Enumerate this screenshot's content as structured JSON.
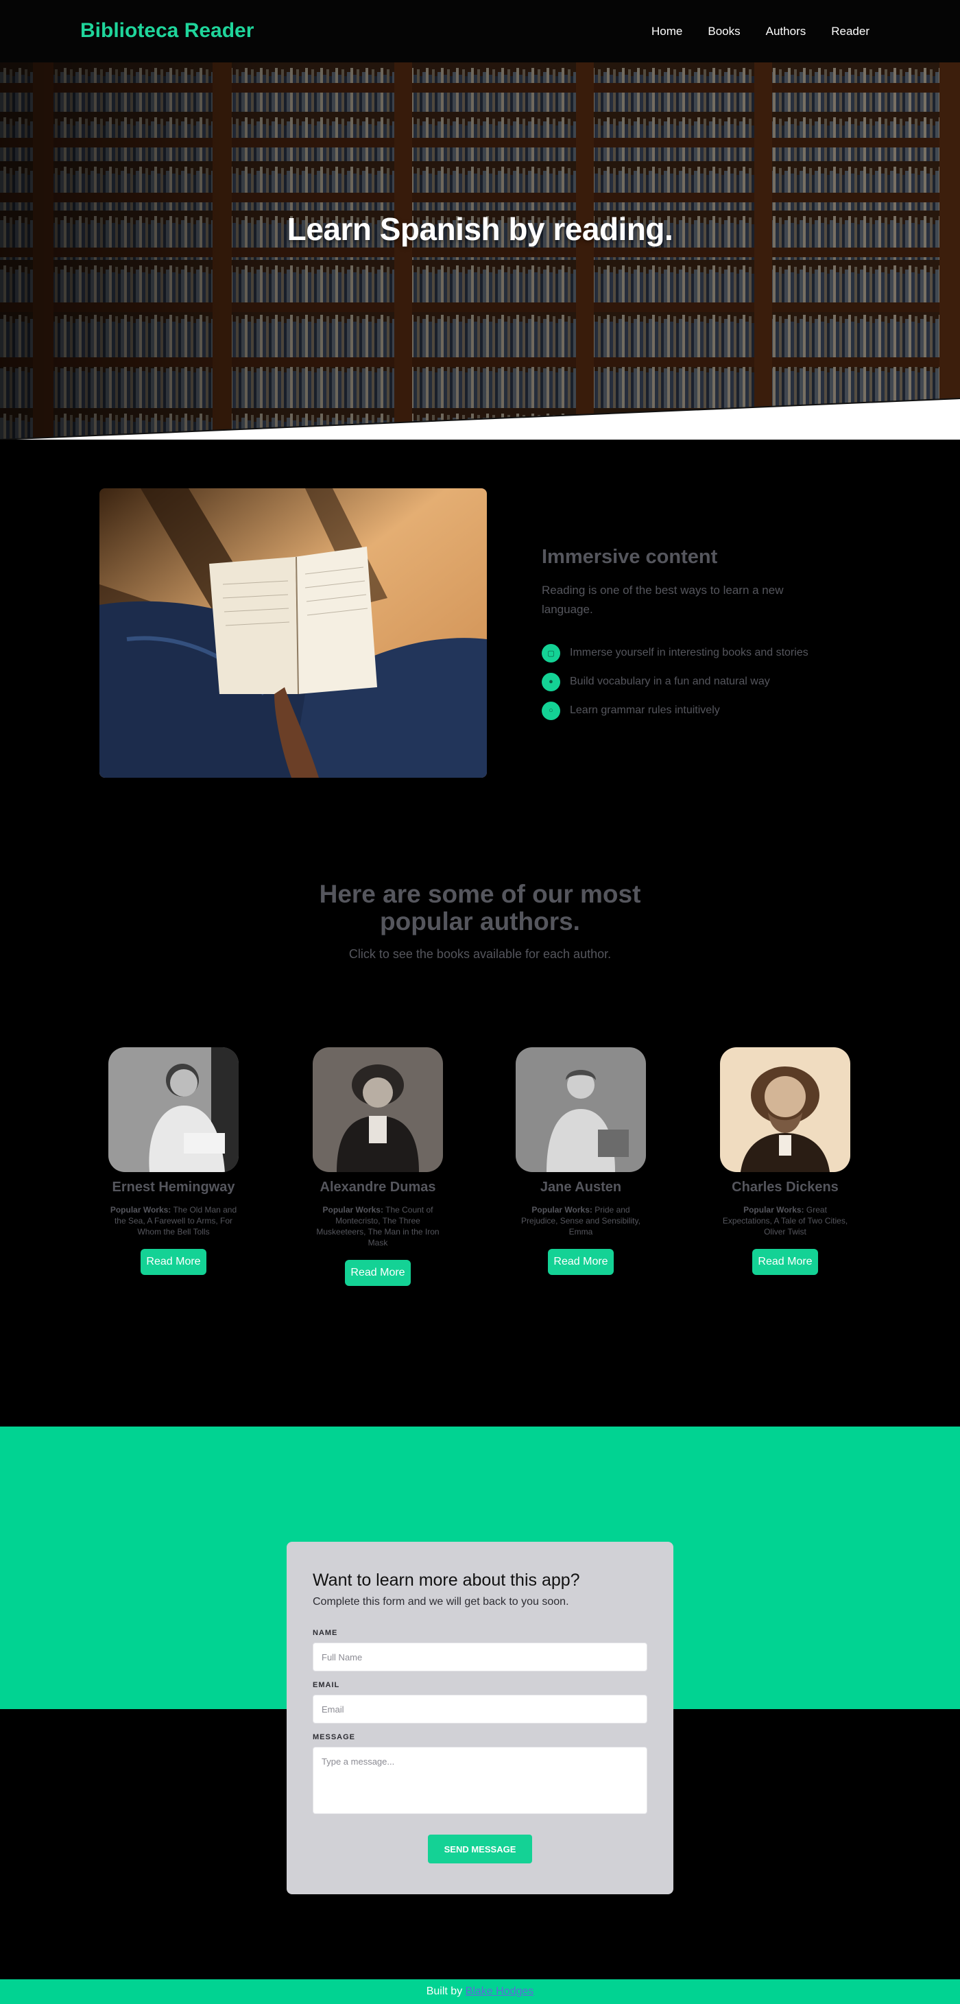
{
  "header": {
    "brand": "Biblioteca Reader",
    "nav": [
      "Home",
      "Books",
      "Authors",
      "Reader"
    ]
  },
  "hero": {
    "title": "Learn Spanish by reading."
  },
  "feature": {
    "title": "Immersive content",
    "subtitle": "Reading is one of the best ways to learn a new language.",
    "items": [
      "Immerse yourself in interesting books and stories",
      "Build vocabulary in a fun and natural way",
      "Learn grammar rules intuitively"
    ]
  },
  "authors": {
    "title": "Here are some of our most popular authors.",
    "subtitle": "Click to see the books available for each author.",
    "works_label": "Popular Works:",
    "button_label": "Read More",
    "list": [
      {
        "name": "Ernest Hemingway",
        "works": "The Old Man and the Sea, A Farewell to Arms, For Whom the Bell Tolls"
      },
      {
        "name": "Alexandre Dumas",
        "works": "The Count of Montecristo, The Three Muskeeteers, The Man in the Iron Mask"
      },
      {
        "name": "Jane Austen",
        "works": "Pride and Prejudice, Sense and Sensibility, Emma"
      },
      {
        "name": "Charles Dickens",
        "works": "Great Expectations, A Tale of Two Cities, Oliver Twist"
      }
    ]
  },
  "contact": {
    "title": "Want to learn more about this app?",
    "subtitle": "Complete this form and we will get back to you soon.",
    "name_label": "NAME",
    "name_placeholder": "Full Name",
    "email_label": "EMAIL",
    "email_placeholder": "Email",
    "message_label": "MESSAGE",
    "message_placeholder": "Type a message...",
    "submit_label": "SEND MESSAGE"
  },
  "footer": {
    "prefix": "Built by",
    "author_link": "Blake Hodges"
  },
  "colors": {
    "accent": "#14d295",
    "band": "#01d392",
    "muted_text": "#55565d"
  }
}
